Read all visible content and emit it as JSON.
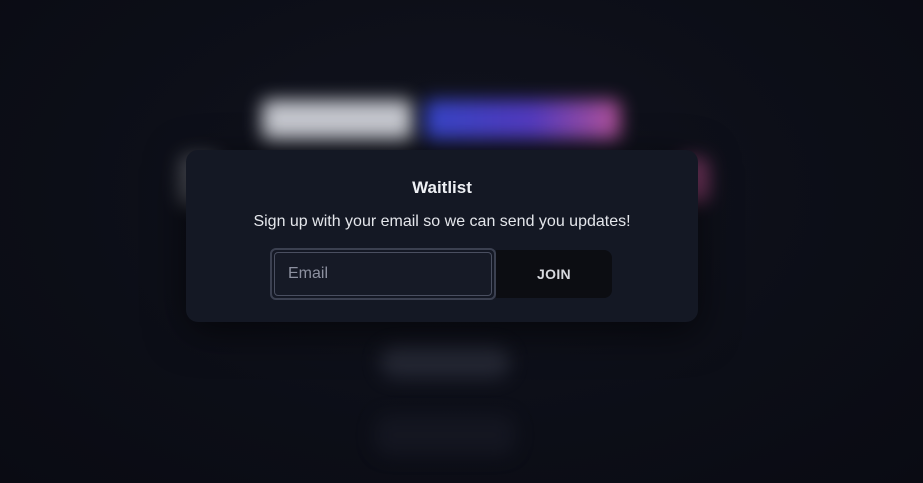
{
  "modal": {
    "title": "Waitlist",
    "subtitle": "Sign up with your email so we can send you updates!",
    "email_placeholder": "Email",
    "email_value": "",
    "join_label": "JOIN"
  },
  "colors": {
    "background": "#0c0e17",
    "modal_background": "#141824",
    "button_background": "#0c0d12",
    "text_primary": "#eef0f4",
    "accent_gradient_start": "#3a4bd8",
    "accent_gradient_end": "#c65aa6"
  }
}
